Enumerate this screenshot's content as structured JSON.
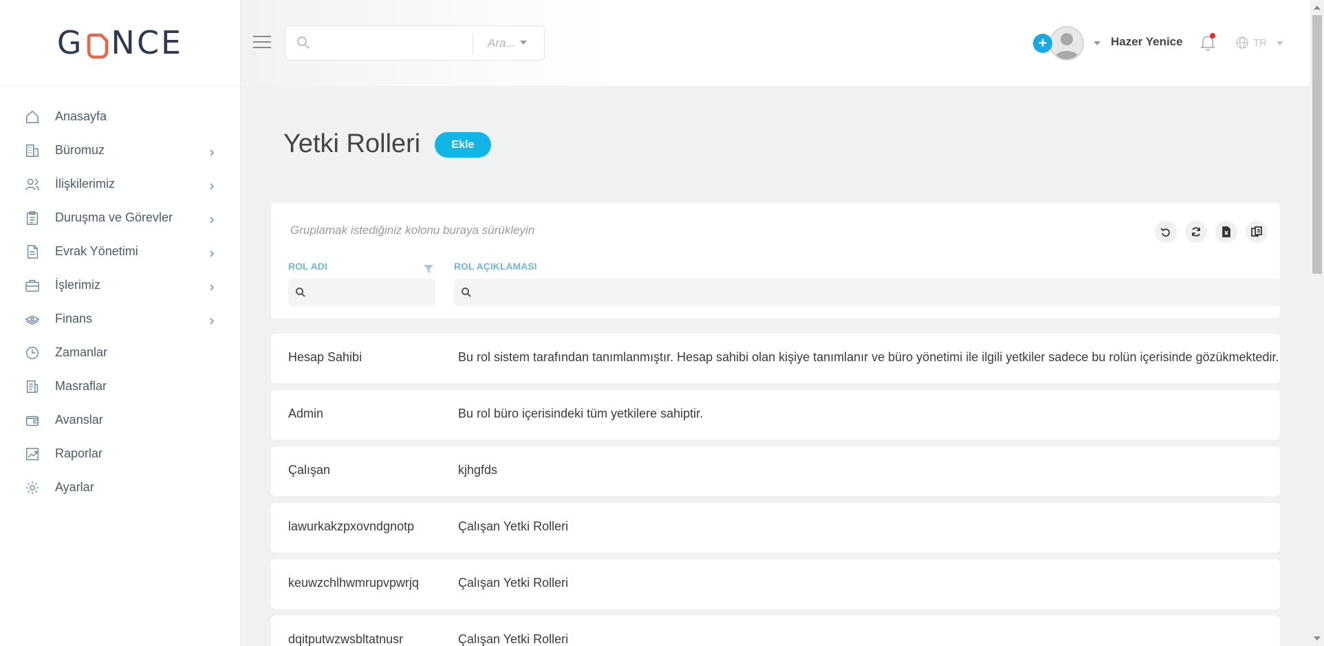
{
  "logo": {
    "text_before": "G",
    "text_after": "NCE"
  },
  "sidebar": {
    "items": [
      {
        "label": "Anasayfa",
        "icon": "home-icon",
        "has_children": false
      },
      {
        "label": "Büromuz",
        "icon": "building-icon",
        "has_children": true
      },
      {
        "label": "İlişkilerimiz",
        "icon": "users-icon",
        "has_children": true
      },
      {
        "label": "Duruşma ve Görevler",
        "icon": "clipboard-icon",
        "has_children": true
      },
      {
        "label": "Evrak Yönetimi",
        "icon": "document-icon",
        "has_children": true
      },
      {
        "label": "İşlerimiz",
        "icon": "briefcase-icon",
        "has_children": true
      },
      {
        "label": "Finans",
        "icon": "money-icon",
        "has_children": true
      },
      {
        "label": "Zamanlar",
        "icon": "clock-icon",
        "has_children": false
      },
      {
        "label": "Masraflar",
        "icon": "receipt-icon",
        "has_children": false
      },
      {
        "label": "Avanslar",
        "icon": "wallet-icon",
        "has_children": false
      },
      {
        "label": "Raporlar",
        "icon": "chart-icon",
        "has_children": false
      },
      {
        "label": "Ayarlar",
        "icon": "gear-icon",
        "has_children": false
      }
    ]
  },
  "header": {
    "search": {
      "value": "",
      "placeholder": "",
      "select_label": "Ara..."
    },
    "user_name": "Hazer Yenice",
    "language": "TR"
  },
  "main": {
    "title": "Yetki Rolleri",
    "add_label": "Ekle",
    "group_hint": "Gruplamak istediğiniz kolonu buraya sürükleyin",
    "columns": [
      "ROL ADI",
      "ROL AÇIKLAMASI"
    ],
    "rows": [
      {
        "name": "Hesap Sahibi",
        "description": "Bu rol sistem tarafından tanımlanmıştır. Hesap sahibi olan kişiye tanımlanır ve büro yönetimi ile ilgili yetkiler sadece bu rolün içerisinde gözükmektedir."
      },
      {
        "name": "Admin",
        "description": "Bu rol büro içerisindeki tüm yetkilere sahiptir."
      },
      {
        "name": "Çalışan",
        "description": "kjhgfds"
      },
      {
        "name": "lawurkakzpxovndgnotp",
        "description": "Çalışan Yetki Rolleri"
      },
      {
        "name": "keuwzchlhwmrupvpwrjq",
        "description": "Çalışan Yetki Rolleri"
      },
      {
        "name": "dqitputwzwsbltatnusr",
        "description": "Çalışan Yetki Rolleri"
      }
    ]
  },
  "colors": {
    "accent": "#12b6e6",
    "brand_dark": "#2b3a4f",
    "brand_orange": "#e8654e",
    "column_header": "#6fb7d8",
    "notification": "#e02c2c"
  }
}
